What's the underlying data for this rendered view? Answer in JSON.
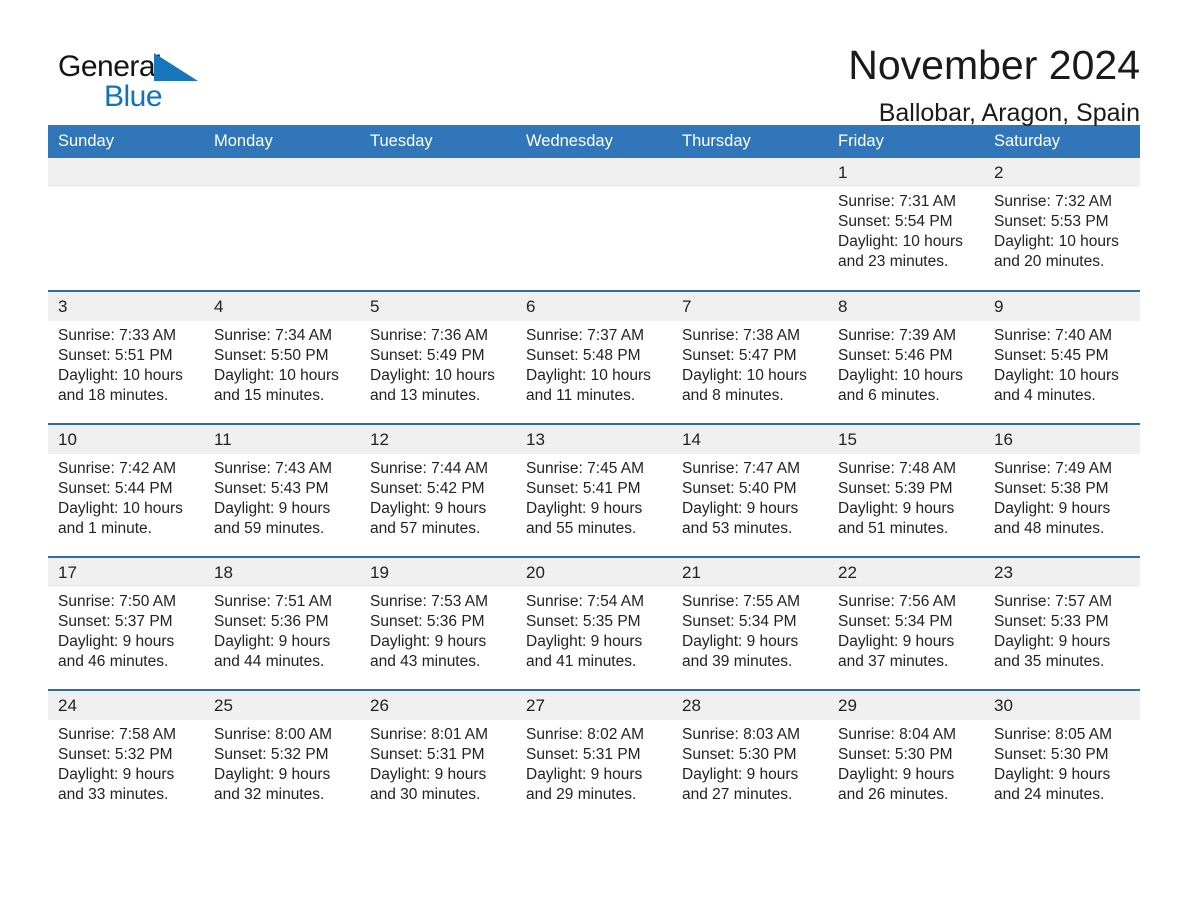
{
  "brand": {
    "name_part1": "General",
    "name_part2": "Blue",
    "logo_icon": "triangle-logo-icon",
    "accent_color": "#1876bd"
  },
  "header": {
    "month_title": "November 2024",
    "location": "Ballobar, Aragon, Spain"
  },
  "calendar": {
    "header_bg": "#3176b8",
    "row_divider_color": "#2e6da4",
    "daynum_bg": "#f0f0f0",
    "weekdays": [
      "Sunday",
      "Monday",
      "Tuesday",
      "Wednesday",
      "Thursday",
      "Friday",
      "Saturday"
    ],
    "weeks": [
      [
        {
          "day": "",
          "lines": []
        },
        {
          "day": "",
          "lines": []
        },
        {
          "day": "",
          "lines": []
        },
        {
          "day": "",
          "lines": []
        },
        {
          "day": "",
          "lines": []
        },
        {
          "day": "1",
          "lines": [
            "Sunrise: 7:31 AM",
            "Sunset: 5:54 PM",
            "Daylight: 10 hours",
            "and 23 minutes."
          ]
        },
        {
          "day": "2",
          "lines": [
            "Sunrise: 7:32 AM",
            "Sunset: 5:53 PM",
            "Daylight: 10 hours",
            "and 20 minutes."
          ]
        }
      ],
      [
        {
          "day": "3",
          "lines": [
            "Sunrise: 7:33 AM",
            "Sunset: 5:51 PM",
            "Daylight: 10 hours",
            "and 18 minutes."
          ]
        },
        {
          "day": "4",
          "lines": [
            "Sunrise: 7:34 AM",
            "Sunset: 5:50 PM",
            "Daylight: 10 hours",
            "and 15 minutes."
          ]
        },
        {
          "day": "5",
          "lines": [
            "Sunrise: 7:36 AM",
            "Sunset: 5:49 PM",
            "Daylight: 10 hours",
            "and 13 minutes."
          ]
        },
        {
          "day": "6",
          "lines": [
            "Sunrise: 7:37 AM",
            "Sunset: 5:48 PM",
            "Daylight: 10 hours",
            "and 11 minutes."
          ]
        },
        {
          "day": "7",
          "lines": [
            "Sunrise: 7:38 AM",
            "Sunset: 5:47 PM",
            "Daylight: 10 hours",
            "and 8 minutes."
          ]
        },
        {
          "day": "8",
          "lines": [
            "Sunrise: 7:39 AM",
            "Sunset: 5:46 PM",
            "Daylight: 10 hours",
            "and 6 minutes."
          ]
        },
        {
          "day": "9",
          "lines": [
            "Sunrise: 7:40 AM",
            "Sunset: 5:45 PM",
            "Daylight: 10 hours",
            "and 4 minutes."
          ]
        }
      ],
      [
        {
          "day": "10",
          "lines": [
            "Sunrise: 7:42 AM",
            "Sunset: 5:44 PM",
            "Daylight: 10 hours",
            "and 1 minute."
          ]
        },
        {
          "day": "11",
          "lines": [
            "Sunrise: 7:43 AM",
            "Sunset: 5:43 PM",
            "Daylight: 9 hours",
            "and 59 minutes."
          ]
        },
        {
          "day": "12",
          "lines": [
            "Sunrise: 7:44 AM",
            "Sunset: 5:42 PM",
            "Daylight: 9 hours",
            "and 57 minutes."
          ]
        },
        {
          "day": "13",
          "lines": [
            "Sunrise: 7:45 AM",
            "Sunset: 5:41 PM",
            "Daylight: 9 hours",
            "and 55 minutes."
          ]
        },
        {
          "day": "14",
          "lines": [
            "Sunrise: 7:47 AM",
            "Sunset: 5:40 PM",
            "Daylight: 9 hours",
            "and 53 minutes."
          ]
        },
        {
          "day": "15",
          "lines": [
            "Sunrise: 7:48 AM",
            "Sunset: 5:39 PM",
            "Daylight: 9 hours",
            "and 51 minutes."
          ]
        },
        {
          "day": "16",
          "lines": [
            "Sunrise: 7:49 AM",
            "Sunset: 5:38 PM",
            "Daylight: 9 hours",
            "and 48 minutes."
          ]
        }
      ],
      [
        {
          "day": "17",
          "lines": [
            "Sunrise: 7:50 AM",
            "Sunset: 5:37 PM",
            "Daylight: 9 hours",
            "and 46 minutes."
          ]
        },
        {
          "day": "18",
          "lines": [
            "Sunrise: 7:51 AM",
            "Sunset: 5:36 PM",
            "Daylight: 9 hours",
            "and 44 minutes."
          ]
        },
        {
          "day": "19",
          "lines": [
            "Sunrise: 7:53 AM",
            "Sunset: 5:36 PM",
            "Daylight: 9 hours",
            "and 43 minutes."
          ]
        },
        {
          "day": "20",
          "lines": [
            "Sunrise: 7:54 AM",
            "Sunset: 5:35 PM",
            "Daylight: 9 hours",
            "and 41 minutes."
          ]
        },
        {
          "day": "21",
          "lines": [
            "Sunrise: 7:55 AM",
            "Sunset: 5:34 PM",
            "Daylight: 9 hours",
            "and 39 minutes."
          ]
        },
        {
          "day": "22",
          "lines": [
            "Sunrise: 7:56 AM",
            "Sunset: 5:34 PM",
            "Daylight: 9 hours",
            "and 37 minutes."
          ]
        },
        {
          "day": "23",
          "lines": [
            "Sunrise: 7:57 AM",
            "Sunset: 5:33 PM",
            "Daylight: 9 hours",
            "and 35 minutes."
          ]
        }
      ],
      [
        {
          "day": "24",
          "lines": [
            "Sunrise: 7:58 AM",
            "Sunset: 5:32 PM",
            "Daylight: 9 hours",
            "and 33 minutes."
          ]
        },
        {
          "day": "25",
          "lines": [
            "Sunrise: 8:00 AM",
            "Sunset: 5:32 PM",
            "Daylight: 9 hours",
            "and 32 minutes."
          ]
        },
        {
          "day": "26",
          "lines": [
            "Sunrise: 8:01 AM",
            "Sunset: 5:31 PM",
            "Daylight: 9 hours",
            "and 30 minutes."
          ]
        },
        {
          "day": "27",
          "lines": [
            "Sunrise: 8:02 AM",
            "Sunset: 5:31 PM",
            "Daylight: 9 hours",
            "and 29 minutes."
          ]
        },
        {
          "day": "28",
          "lines": [
            "Sunrise: 8:03 AM",
            "Sunset: 5:30 PM",
            "Daylight: 9 hours",
            "and 27 minutes."
          ]
        },
        {
          "day": "29",
          "lines": [
            "Sunrise: 8:04 AM",
            "Sunset: 5:30 PM",
            "Daylight: 9 hours",
            "and 26 minutes."
          ]
        },
        {
          "day": "30",
          "lines": [
            "Sunrise: 8:05 AM",
            "Sunset: 5:30 PM",
            "Daylight: 9 hours",
            "and 24 minutes."
          ]
        }
      ]
    ]
  }
}
